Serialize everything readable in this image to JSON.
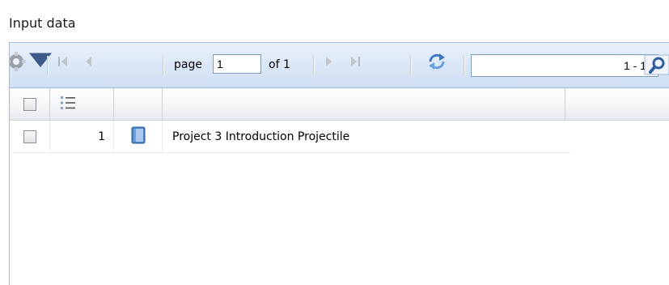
{
  "panel": {
    "title": "Input data"
  },
  "toolbar": {
    "icons": {
      "options": "gear-icon",
      "options_arrow": "chevron-down-icon",
      "first": "first-page-icon",
      "prev": "prev-page-icon",
      "next": "next-page-icon",
      "last": "last-page-icon",
      "refresh": "refresh-icon",
      "search": "search-icon"
    },
    "page_label": "page",
    "page_value": "1",
    "of_label": "of 1",
    "search_value": "1 - 1"
  },
  "grid": {
    "header_icons": {
      "row_numbers": "numbered-list-icon"
    },
    "rows": [
      {
        "number": "1",
        "icon": "book-icon",
        "name": "Project 3 Introduction Projectile",
        "checked": false
      }
    ]
  },
  "colors": {
    "toolbar_bg": "#d9e6f7",
    "border": "#99bbe8",
    "icon_blue": "#3e7bc6"
  }
}
